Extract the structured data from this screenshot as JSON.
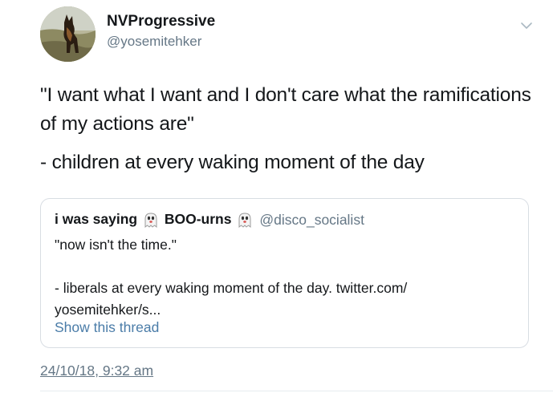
{
  "author": {
    "display_name": "NVProgressive",
    "handle": "@yosemitehker",
    "avatar_icon": "dog-photo-avatar"
  },
  "tweet": {
    "line1": "\"I want what I want and I don't care what the ramifications of my actions are\"",
    "line2": "- children at every waking moment of the day",
    "timestamp": "24/10/18, 9:32 am"
  },
  "quoted_tweet": {
    "name_part1": "i was saying ",
    "name_part2": "BOO-urns",
    "handle": "@disco_socialist",
    "text_line1": "\"now isn't the time.\"",
    "text_line2": "- liberals at every waking moment of the day. twitter.com/",
    "text_line3": "yosemitehker/s...",
    "show_thread": "Show this thread",
    "emoji_icon": "ghost-emoji-icon"
  },
  "colors": {
    "text": "#14171a",
    "secondary": "#657786",
    "link": "#4a7ca8",
    "border": "#d8dde3"
  }
}
